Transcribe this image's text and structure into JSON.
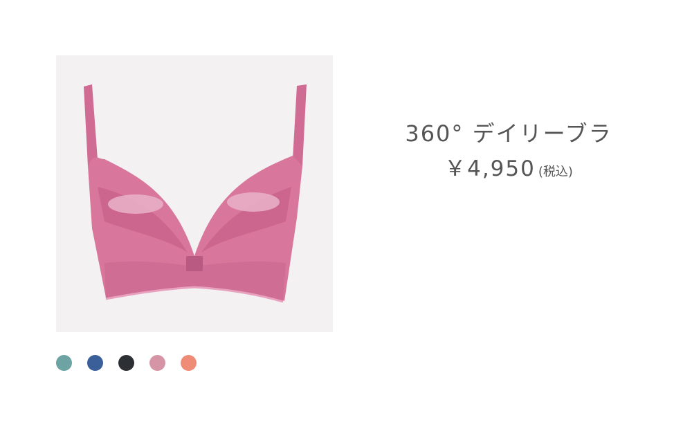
{
  "product": {
    "name": "360° デイリーブラ",
    "price": "￥4,950",
    "tax_note": "(税込)"
  },
  "image": {
    "icon": "bra-product-image",
    "background_color": "#f3f1f1",
    "garment_color": "#d8769b"
  },
  "color_swatches": [
    {
      "icon": "swatch-teal",
      "color": "#6da3a3"
    },
    {
      "icon": "swatch-blue",
      "color": "#3a5f99"
    },
    {
      "icon": "swatch-black",
      "color": "#2c3035"
    },
    {
      "icon": "swatch-pink",
      "color": "#d595a7"
    },
    {
      "icon": "swatch-coral",
      "color": "#ef8c78"
    }
  ]
}
